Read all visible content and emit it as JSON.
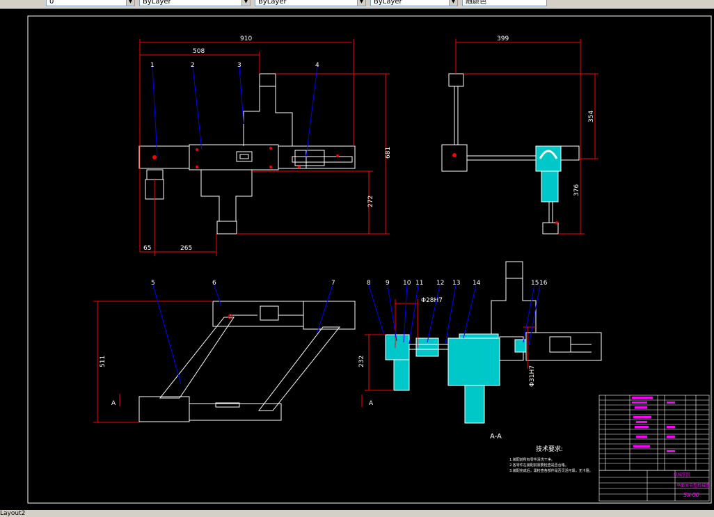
{
  "toolbar": {
    "layer_combo": "0",
    "color_combo": "ByLayer",
    "linetype_combo": "ByLayer",
    "lineweight_combo": "ByLayer",
    "plotstyle_combo": "随颜色"
  },
  "drawing": {
    "dims": {
      "top_width": "910",
      "top_inner": "508",
      "height_total": "681",
      "height_lower": "272",
      "left_offset": "65",
      "left_span": "265",
      "side_width": "399",
      "side_upper": "354",
      "side_lower": "376",
      "bottom_height": "511",
      "section_height": "232",
      "bore_1": "Φ28H7",
      "bore_2": "Φ31H7"
    },
    "balloons_top": [
      "1",
      "2",
      "3",
      "4"
    ],
    "balloons_bottom": [
      "5",
      "6",
      "7"
    ],
    "balloons_section": [
      "8",
      "9",
      "10",
      "11",
      "12",
      "13",
      "14",
      "15",
      "16"
    ],
    "section_marker": "A",
    "section_label": "A-A",
    "notes_title": "技术要求:",
    "notes": [
      "1.装配前所有零件清洗干净。",
      "2.各零件在装配前需要检查是否合格。",
      "3.装配完成后，需检查各部件是否灵活可靠，无卡阻。"
    ],
    "title_block": {
      "drawing_no": "SX-00",
      "school": "机械学院",
      "title": "平面关节型机械手"
    }
  },
  "status": {
    "layout_tab": "Layout2"
  },
  "colors": {
    "background": "#000000",
    "outline": "#ffffff",
    "dimension": "#ff0000",
    "leader": "#0000ff",
    "section_fill": "#00c8c8",
    "title_text": "#ff00ff"
  }
}
